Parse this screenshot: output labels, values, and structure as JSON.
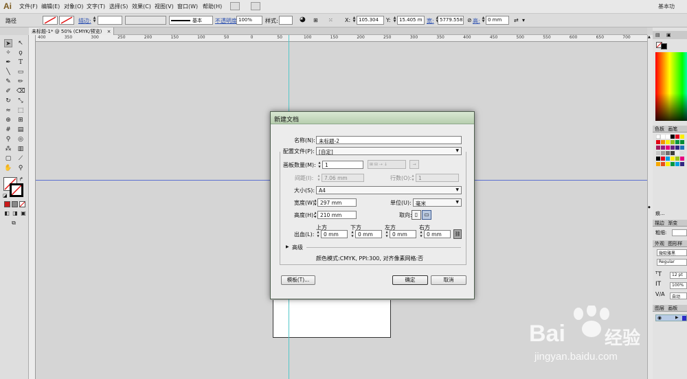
{
  "menubar": {
    "logo": "Ai",
    "items": [
      "文件(F)",
      "编辑(E)",
      "对象(O)",
      "文字(T)",
      "选择(S)",
      "效果(C)",
      "视图(V)",
      "窗口(W)",
      "帮助(H)"
    ],
    "workspace": "基本功"
  },
  "controlbar": {
    "selection_label": "路径",
    "stroke_label": "描边:",
    "stroke_style": "基本",
    "opacity_label": "不透明度",
    "opacity_value": "100%",
    "style_label": "样式:",
    "x_label": "X:",
    "x_value": "105.304",
    "y_label": "Y:",
    "y_value": "15.405 m",
    "w_label": "宽:",
    "w_value": "5779.558",
    "h_label": "高:",
    "h_value": "0 mm"
  },
  "document_tab": {
    "title": "未标题-1* @ 50% (CMYK/预览)",
    "close": "×"
  },
  "ruler": {
    "top_ticks": [
      "400",
      "350",
      "300",
      "250",
      "200",
      "150",
      "100",
      "50",
      "0",
      "50",
      "100",
      "150",
      "200",
      "250",
      "300",
      "350",
      "400",
      "450",
      "500",
      "550",
      "600",
      "650",
      "700"
    ]
  },
  "panels": {
    "color_tabs": [
      "色板",
      "画笔"
    ],
    "stroke_tabs": [
      "描边",
      "渐变"
    ],
    "weight_label": "粗细:",
    "appearance_tabs": [
      "外观",
      "图形样"
    ],
    "font_name": "微软雅黑",
    "font_style": "Regular",
    "font_size": "12 pt",
    "scale": "100%",
    "tracking": "自动",
    "layers_tabs": [
      "图层",
      "画板"
    ],
    "misc_label": "痕..."
  },
  "dialog": {
    "title": "新建文档",
    "name_label": "名称(N):",
    "name_value": "未标题-2",
    "profile_label": "配置文件(P):",
    "profile_value": "[自定]",
    "artboards_label": "画板数量(M):",
    "artboards_value": "1",
    "spacing_label": "间距(I):",
    "spacing_value": "7.06 mm",
    "columns_label": "行数(O):",
    "columns_value": "1",
    "size_label": "大小(S):",
    "size_value": "A4",
    "width_label": "宽度(W):",
    "width_value": "297 mm",
    "units_label": "单位(U):",
    "units_value": "毫米",
    "height_label": "高度(H):",
    "height_value": "210 mm",
    "orientation_label": "取向:",
    "bleed_label": "出血(L):",
    "bleed_top_label": "上方",
    "bleed_top": "0 mm",
    "bleed_bottom_label": "下方",
    "bleed_bottom": "0 mm",
    "bleed_left_label": "左方",
    "bleed_left": "0 mm",
    "bleed_right_label": "右方",
    "bleed_right": "0 mm",
    "advanced_label": "高级",
    "info_text": "颜色模式:CMYK, PPI:300, 对齐像素网格:否",
    "templates_button": "模板(T)...",
    "ok_button": "确定",
    "cancel_button": "取消"
  },
  "watermark": {
    "brand": "Bai",
    "brand2": "经验",
    "url": "jingyan.baidu.com"
  }
}
